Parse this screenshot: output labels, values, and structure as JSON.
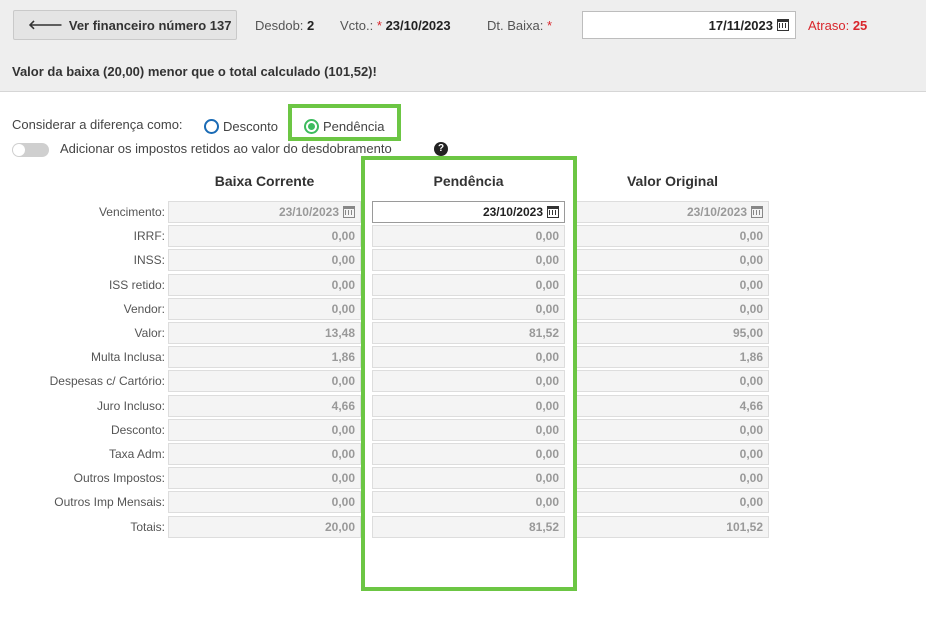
{
  "header": {
    "back_button": "Ver financeiro número 137",
    "desdob_label": "Desdob:",
    "desdob_value": "2",
    "vcto_label": "Vcto.:",
    "vcto_value": "23/10/2023",
    "dt_baixa_label": "Dt. Baixa:",
    "dt_baixa_value": "17/11/2023",
    "atraso_label": "Atraso:",
    "atraso_value": "25",
    "warning": "Valor da baixa (20,00) menor que o total calculado (101,52)!"
  },
  "options": {
    "considerar_label": "Considerar a diferença como:",
    "radio_desconto": "Desconto",
    "radio_pendencia": "Pendência",
    "selected": "Pendência",
    "toggle_label": "Adicionar os impostos retidos ao valor do desdobramento"
  },
  "columns": [
    "Baixa Corrente",
    "Pendência",
    "Valor Original"
  ],
  "rows": [
    {
      "label": "Vencimento:",
      "values": [
        "23/10/2023",
        "23/10/2023",
        "23/10/2023"
      ]
    },
    {
      "label": "IRRF:",
      "values": [
        "0,00",
        "0,00",
        "0,00"
      ]
    },
    {
      "label": "INSS:",
      "values": [
        "0,00",
        "0,00",
        "0,00"
      ]
    },
    {
      "label": "ISS retido:",
      "values": [
        "0,00",
        "0,00",
        "0,00"
      ]
    },
    {
      "label": "Vendor:",
      "values": [
        "0,00",
        "0,00",
        "0,00"
      ]
    },
    {
      "label": "Valor:",
      "values": [
        "13,48",
        "81,52",
        "95,00"
      ]
    },
    {
      "label": "Multa Inclusa:",
      "values": [
        "1,86",
        "0,00",
        "1,86"
      ]
    },
    {
      "label": "Despesas c/ Cartório:",
      "values": [
        "0,00",
        "0,00",
        "0,00"
      ]
    },
    {
      "label": "Juro Incluso:",
      "values": [
        "4,66",
        "0,00",
        "4,66"
      ]
    },
    {
      "label": "Desconto:",
      "values": [
        "0,00",
        "0,00",
        "0,00"
      ]
    },
    {
      "label": "Taxa Adm:",
      "values": [
        "0,00",
        "0,00",
        "0,00"
      ]
    },
    {
      "label": "Outros Impostos:",
      "values": [
        "0,00",
        "0,00",
        "0,00"
      ]
    },
    {
      "label": "Outros Imp Mensais:",
      "values": [
        "0,00",
        "0,00",
        "0,00"
      ]
    },
    {
      "label": "Totais:",
      "values": [
        "20,00",
        "81,52",
        "101,52"
      ]
    }
  ],
  "colors": {
    "highlight": "#6cc644",
    "required": "#d9262c",
    "radio_blue": "#1a6bb5",
    "radio_green": "#3dbb5e"
  }
}
